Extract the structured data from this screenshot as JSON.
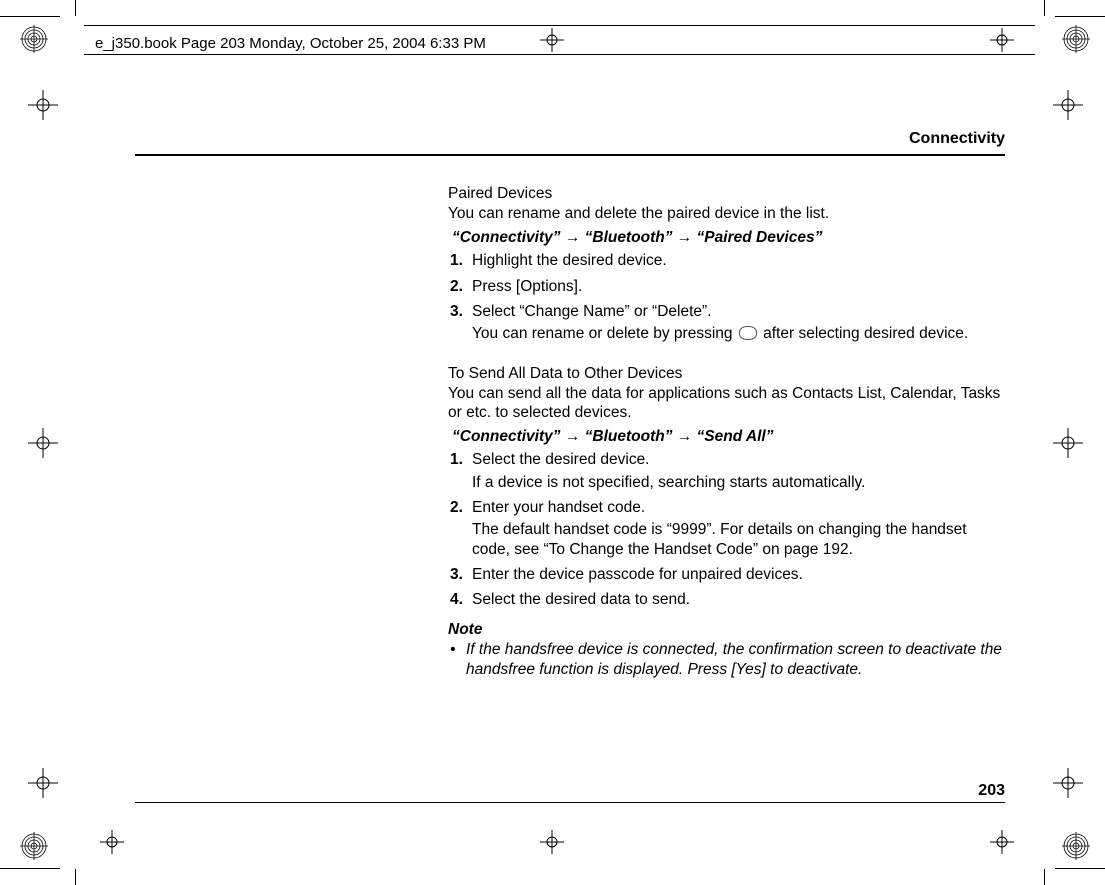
{
  "header": {
    "filename_line": "e_j350.book  Page 203  Monday, October 25, 2004  6:33 PM"
  },
  "section_title": "Connectivity",
  "sec1": {
    "subhead": "Paired Devices",
    "intro": "You can rename and delete the paired device in the list.",
    "path": "“Connectivity” → “Bluetooth” → “Paired Devices”",
    "steps": [
      {
        "n": "1.",
        "t": "Highlight the desired device."
      },
      {
        "n": "2.",
        "t": "Press [Options]."
      },
      {
        "n": "3.",
        "t": "Select “Change Name” or “Delete”.",
        "sub_pre": "You can rename or delete by pressing ",
        "sub_post": " after selecting desired device."
      }
    ]
  },
  "sec2": {
    "subhead": "To Send All Data to Other Devices",
    "intro": "You can send all the data for applications such as Contacts List, Calendar, Tasks or etc. to selected devices.",
    "path": "“Connectivity” → “Bluetooth” → “Send All”",
    "steps": [
      {
        "n": "1.",
        "t": "Select the desired device.",
        "sub": "If a device is not specified, searching starts automatically."
      },
      {
        "n": "2.",
        "t": "Enter your handset code.",
        "sub": "The default handset code is “9999”. For details on changing the handset code, see “To Change the Handset Code” on page 192."
      },
      {
        "n": "3.",
        "t": "Enter the device passcode for unpaired devices."
      },
      {
        "n": "4.",
        "t": "Select the desired data to send."
      }
    ]
  },
  "note": {
    "head": "Note",
    "bullet": "•",
    "text": "If the handsfree device is connected, the confirmation screen to deactivate the handsfree function is displayed. Press [Yes] to deactivate."
  },
  "page_number": "203"
}
